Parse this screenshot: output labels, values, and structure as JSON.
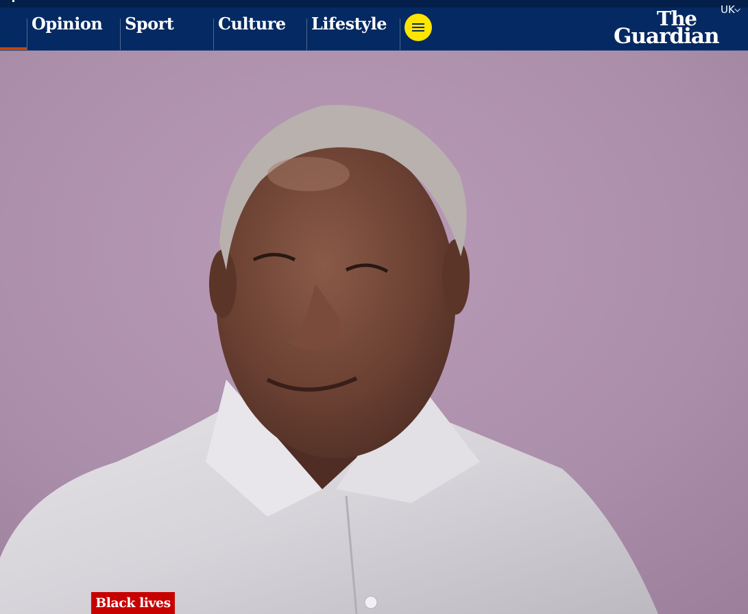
{
  "brand": {
    "logo_line1": "The",
    "logo_line2": "Guardian",
    "nav_background": "#052962",
    "accent_indicator": "#c74600",
    "menu_button_color": "#ffe500",
    "kicker_color": "#c70000"
  },
  "nav": {
    "items": [
      {
        "label": "Opinion"
      },
      {
        "label": "Sport"
      },
      {
        "label": "Culture"
      },
      {
        "label": "Lifestyle"
      }
    ],
    "menu_icon": "hamburger-icon",
    "edition": "UK",
    "edition_icon": "chevron-down-icon"
  },
  "hero": {
    "image_alt": "Portrait of an elderly man in a white shirt against a pink wall",
    "background_color": "#ad93ab"
  },
  "article": {
    "kicker": "Black lives"
  }
}
